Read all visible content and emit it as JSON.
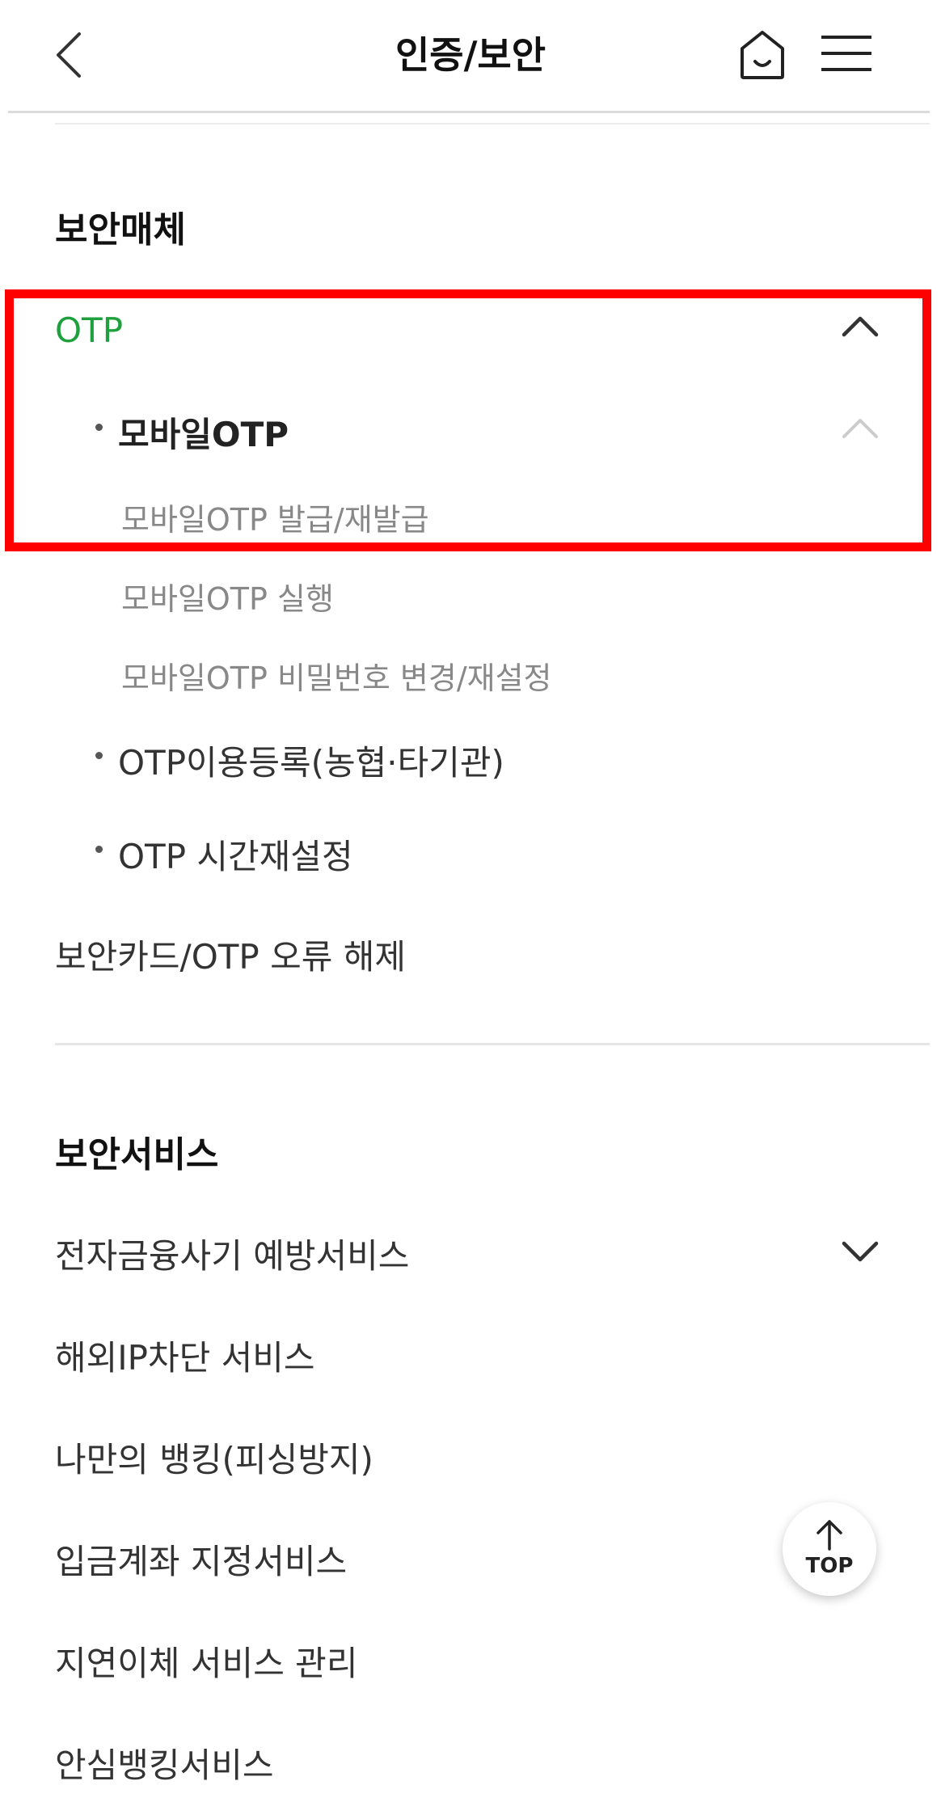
{
  "header": {
    "title": "인증/보안",
    "back_icon": "chevron-left-icon",
    "home_icon": "home-icon",
    "menu_icon": "hamburger-menu-icon"
  },
  "security_media": {
    "title": "보안매체",
    "otp": {
      "label": "OTP",
      "color": "#1ea03c",
      "mobile_otp": {
        "label": "모바일OTP",
        "items": [
          "모바일OTP 발급/재발급",
          "모바일OTP 실행",
          "모바일OTP 비밀번호 변경/재설정"
        ]
      },
      "otp_register": "OTP이용등록(농협·타기관)",
      "otp_time_reset": "OTP 시간재설정"
    },
    "error_release": "보안카드/OTP 오류 해제"
  },
  "security_services": {
    "title": "보안서비스",
    "items": [
      "전자금융사기 예방서비스",
      "해외IP차단 서비스",
      "나만의 뱅킹(피싱방지)",
      "입금계좌 지정서비스",
      "지연이체 서비스 관리",
      "안심뱅킹서비스"
    ]
  },
  "top_button": {
    "label": "TOP",
    "icon": "arrow-up-icon"
  },
  "highlight_color": "#ff0000"
}
